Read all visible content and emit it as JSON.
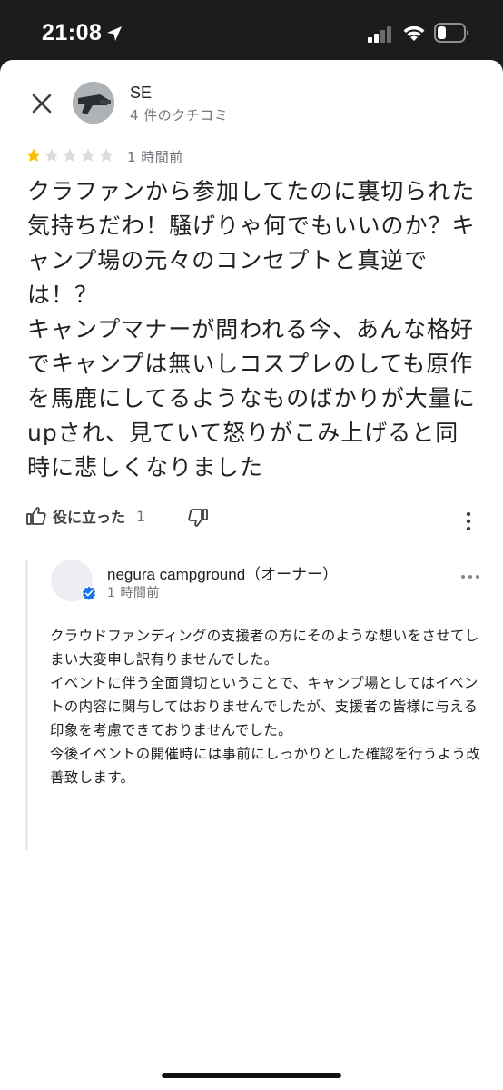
{
  "status_bar": {
    "time": "21:08",
    "icons": [
      "location-arrow-icon",
      "signal-icon",
      "wifi-icon",
      "battery-icon"
    ]
  },
  "review": {
    "reviewer_name": "SE",
    "reviewer_meta": "4 件のクチコミ",
    "rating": 1,
    "rating_max": 5,
    "time": "1 時間前",
    "text": "クラファンから参加してたのに裏切られた気持ちだわ！騒げりゃ何でもいいのか？キャンプ場の元々のコンセプトと真逆では！？\nキャンプマナーが問われる今、あんな格好でキャンプは無いしコスプレのしても原作を馬鹿にしてるようなものばかりが大量にupされ、見ていて怒りがこみ上げると同時に悲しくなりました",
    "helpful_label": "役に立った",
    "helpful_count": "1"
  },
  "owner_reply": {
    "name": "negura campground（オーナー）",
    "time": "1 時間前",
    "text": "クラウドファンディングの支援者の方にそのような想いをさせてしまい大変申し訳有りませんでした。\nイベントに伴う全面貸切ということで、キャンプ場としてはイベントの内容に関与してはおりませんでしたが、支援者の皆様に与える印象を考慮できておりませんでした。\n今後イベントの開催時には事前にしっかりとした確認を行うよう改善致します。"
  },
  "colors": {
    "star_filled": "#fbbc04",
    "star_empty": "#dadce0",
    "verified": "#1a73e8",
    "text_secondary": "#70757a"
  }
}
